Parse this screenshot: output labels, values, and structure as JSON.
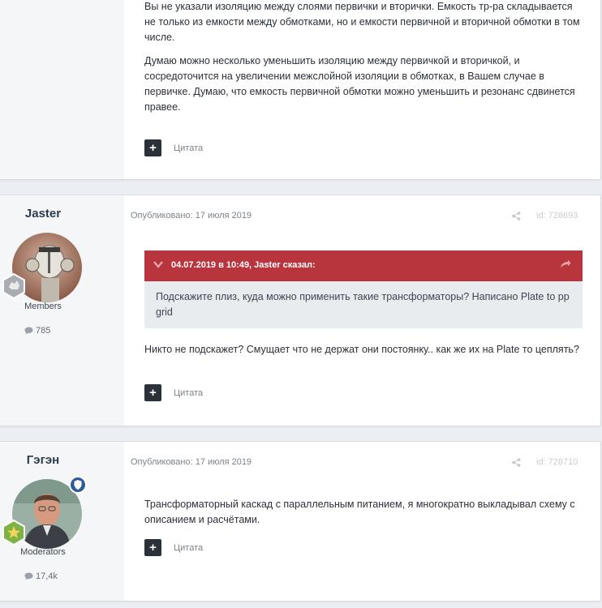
{
  "colors": {
    "quote_header": "#b9353e",
    "page_bg": "#ebeef2",
    "author_bg": "#f5f6f8"
  },
  "posts": [
    {
      "paragraphs": [
        "Вы не указали изоляцию между слоями первички и вторички. Емкость тр-ра складывается не только из емкости между обмотками, но и емкости первичной и вторичной обмотки в том числе.",
        "Думаю можно несколько уменьшить изоляцию между первичкой и вторичкой, и сосредоточится на увеличении межслойной изоляции в обмотках, в Вашем случае в первичке. Думаю, что емкость первичной обмотки можно уменьшить и резонанс сдвинется правее."
      ],
      "quote_label": "Цитата",
      "quote_icon": "plus-icon"
    },
    {
      "author": "Jaster",
      "group": "Members",
      "post_count": "785",
      "published": "Опубликовано: 17 июля 2019",
      "post_id": "id: 728693",
      "share_icon": "share-icon",
      "quote": {
        "citation": "04.07.2019 в 10:49, Jaster сказал:",
        "text": "Подскажите плиз, куда можно применить такие трансформаторы? Написано Plate to pp grid"
      },
      "text": "Никто не подскажет? Смущает что не держат они постоянку.. как же их на Plate то цеплять?",
      "quote_label": "Цитата"
    },
    {
      "author": "Гэгэн",
      "group": "Moderators",
      "post_count": "17,4k",
      "published": "Опубликовано: 17 июля 2019",
      "post_id": "id: 728710",
      "share_icon": "share-icon",
      "text": "Трансформаторный каскад с параллельным питанием, я многократно  выкладывал схему  с описанием и расчётами.",
      "quote_label": "Цитата"
    }
  ]
}
